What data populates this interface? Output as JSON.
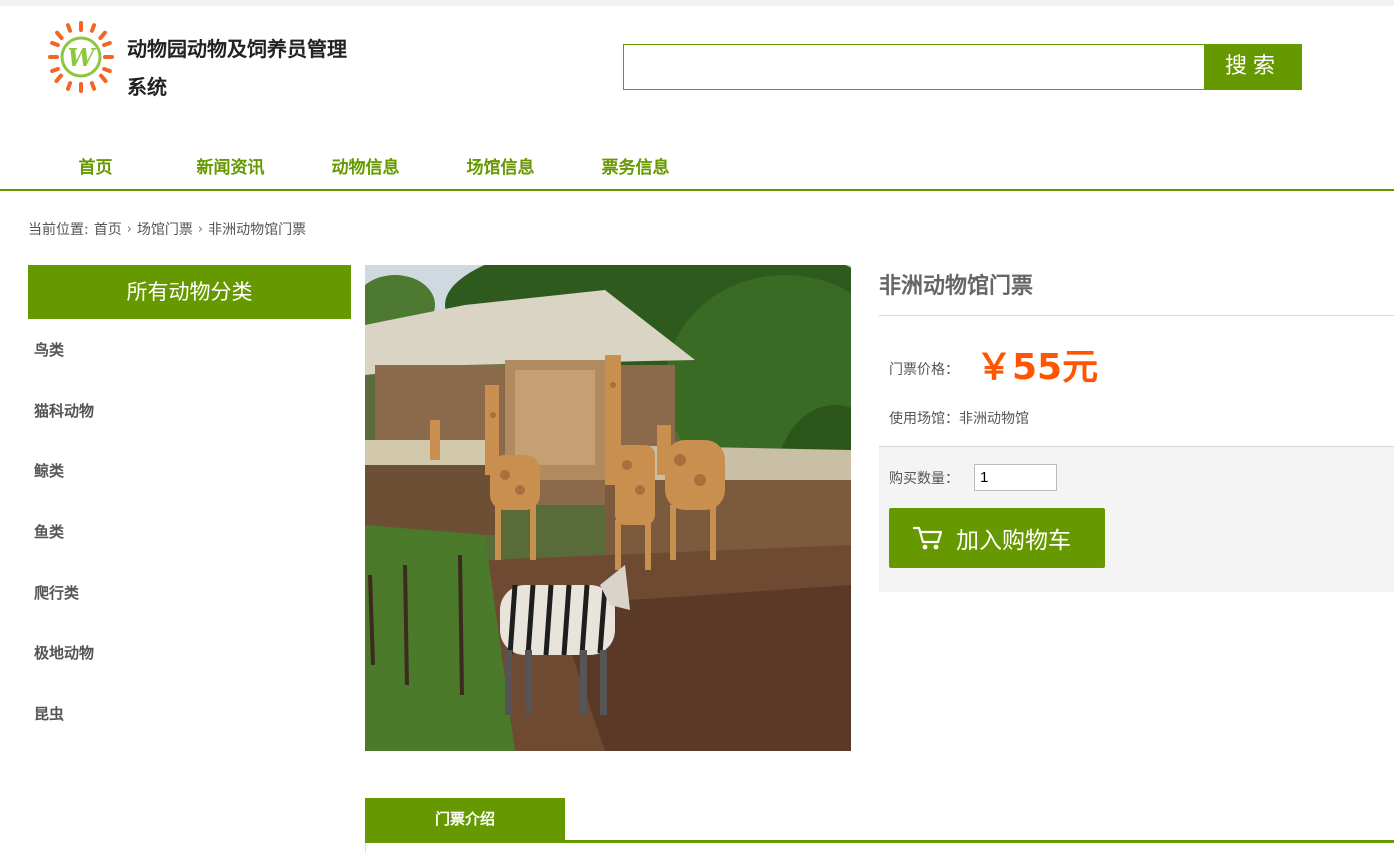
{
  "header": {
    "site_title": "动物园动物及饲养员管理系统",
    "search": {
      "value": "",
      "placeholder": "",
      "button_label": "搜索"
    },
    "logo_icon": "sun-w-logo-icon"
  },
  "nav": {
    "items": [
      "首页",
      "新闻资讯",
      "动物信息",
      "场馆信息",
      "票务信息"
    ]
  },
  "breadcrumb": {
    "prefix": "当前位置:",
    "items": [
      "首页",
      "场馆门票",
      "非洲动物馆门票"
    ]
  },
  "sidebar": {
    "title": "所有动物分类",
    "items": [
      "鸟类",
      "猫科动物",
      "鲸类",
      "鱼类",
      "爬行类",
      "极地动物",
      "昆虫"
    ]
  },
  "product": {
    "title": "非洲动物馆门票",
    "price_label": "门票价格：",
    "price_value": "￥55元",
    "venue_label": "使用场馆：",
    "venue_value": "非洲动物馆",
    "quantity_label": "购买数量：",
    "quantity_value": "1",
    "cart_button_label": "加入购物车",
    "cart_icon": "shopping-cart-icon"
  },
  "tabs": {
    "active_label": "门票介绍"
  },
  "colors": {
    "accent": "#669900",
    "price": "#ff5500"
  }
}
